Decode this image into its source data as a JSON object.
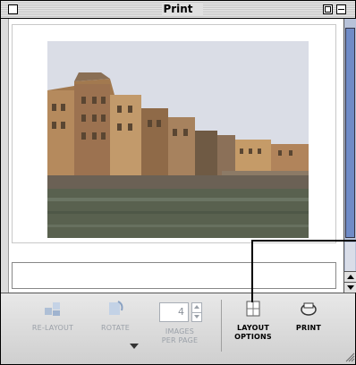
{
  "window": {
    "title": "Print"
  },
  "preview": {
    "photo_description_icon": "photo-icon"
  },
  "toolbar": {
    "relayout": {
      "label": "RE-LAYOUT",
      "enabled": false
    },
    "rotate": {
      "label": "ROTATE",
      "enabled": false
    },
    "pages_per_page": {
      "value": "4",
      "label_line1": "IMAGES",
      "label_line2": "PER PAGE",
      "enabled": false
    },
    "layout_options": {
      "label_line1": "LAYOUT",
      "label_line2": "OPTIONS",
      "enabled": true
    },
    "print": {
      "label": "PRINT",
      "enabled": true
    }
  },
  "colors": {
    "scroll_thumb": "#6f8bc7",
    "disabled_text": "#9aa0a8",
    "enabled_text": "#000000"
  }
}
